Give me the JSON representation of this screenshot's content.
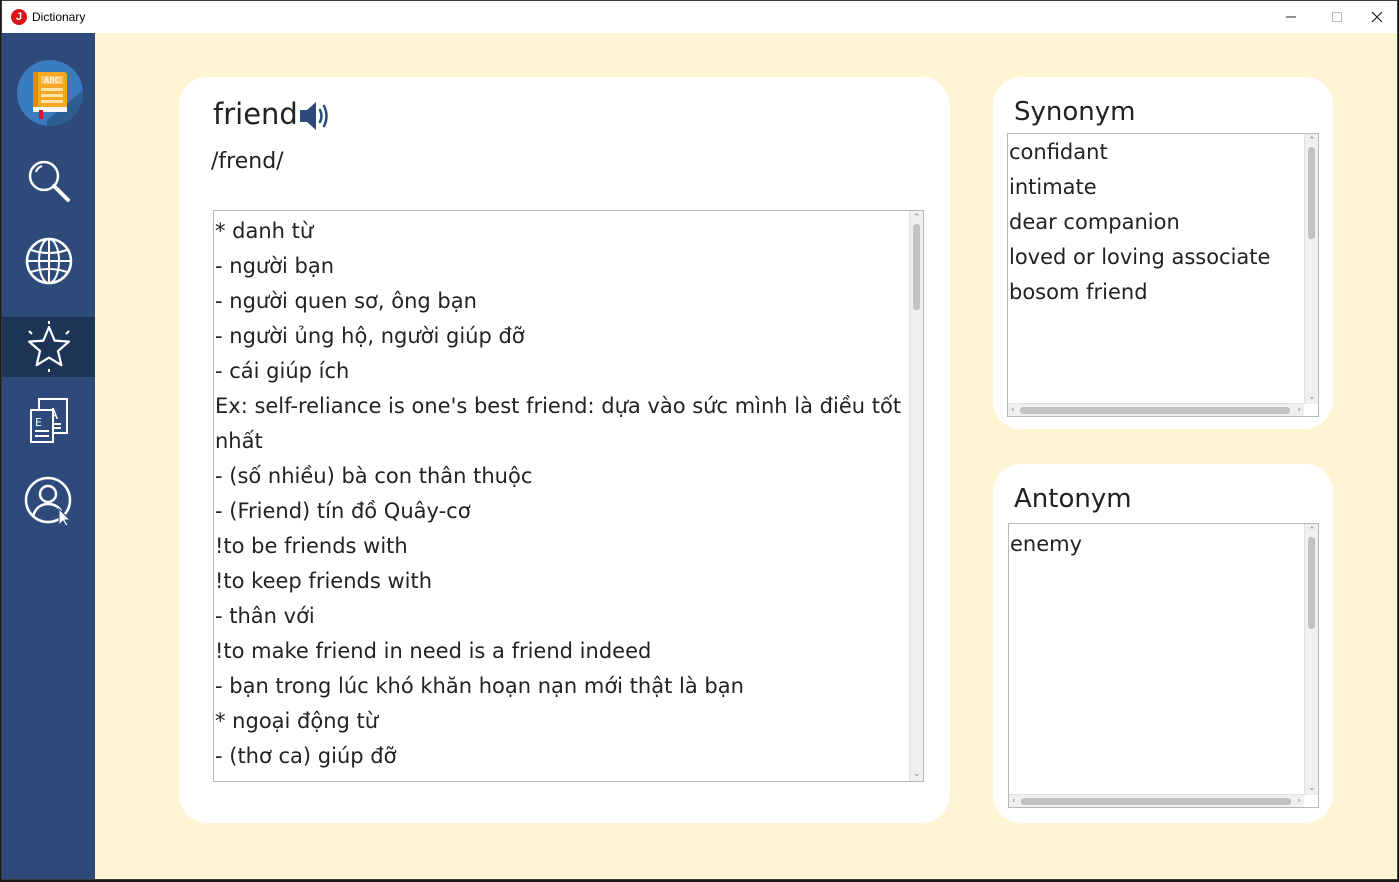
{
  "window": {
    "title": "Dictionary",
    "app_icon_letter": "J"
  },
  "sidebar": {
    "items": [
      {
        "name": "search",
        "icon": "magnifier-icon"
      },
      {
        "name": "translate",
        "icon": "globe-icon"
      },
      {
        "name": "favorites",
        "icon": "star-icon",
        "active": true
      },
      {
        "name": "flashcards",
        "icon": "text-document-icon"
      },
      {
        "name": "account",
        "icon": "user-account-icon"
      }
    ]
  },
  "entry": {
    "word": "friend",
    "phonetic": "/frend/",
    "definition_lines": [
      "*  danh từ",
      "- người bạn",
      "- người quen sơ, ông bạn",
      "- người ủng hộ, người giúp đỡ",
      "- cái giúp ích",
      "Ex: self-reliance is one's best friend: dựa vào sức mình là điều tốt",
      "nhất",
      "- (số nhiều) bà con thân thuộc",
      "- (Friend) tín đồ Quây-cơ",
      "!to be friends with",
      "!to keep friends with",
      "- thân với",
      "!to make friend in need is a friend indeed",
      "- bạn trong lúc khó khăn hoạn nạn mới thật là bạn",
      "*  ngoại động từ",
      "- (thơ ca) giúp đỡ"
    ]
  },
  "synonym": {
    "title": "Synonym",
    "items": [
      "confidant",
      "intimate",
      "dear companion",
      "loved or loving associate",
      "bosom friend"
    ]
  },
  "antonym": {
    "title": "Antonym",
    "items": [
      "enemy"
    ]
  },
  "colors": {
    "sidebar": "#2d4a7a",
    "sidebar_active": "#1e3457",
    "background": "#fff4d3",
    "card": "#ffffff",
    "app_icon": "#d8131a"
  }
}
